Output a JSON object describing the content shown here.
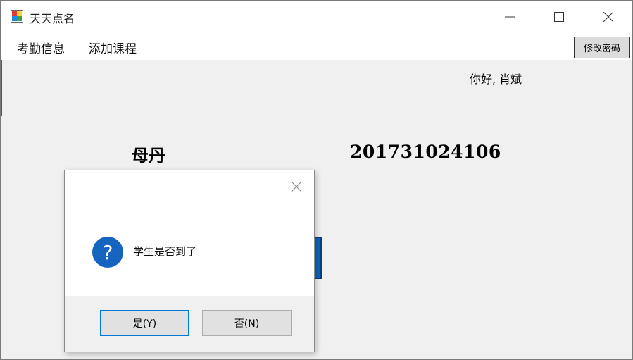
{
  "window": {
    "title": "天天点名",
    "minimize_icon": "minimize-icon",
    "maximize_icon": "maximize-icon",
    "close_icon": "close-icon"
  },
  "menu": {
    "items": [
      {
        "label": "考勤信息"
      },
      {
        "label": "添加课程"
      }
    ],
    "change_password_label": "修改密码"
  },
  "greeting": "你好, 肖斌",
  "student": {
    "name": "母丹",
    "id": "201731024106"
  },
  "dialog": {
    "message": "学生是否到了",
    "icon": "question-icon",
    "yes_label": "是(Y)",
    "no_label": "否(N)"
  },
  "colors": {
    "accent": "#0078d7",
    "question_icon": "#1565c0"
  }
}
